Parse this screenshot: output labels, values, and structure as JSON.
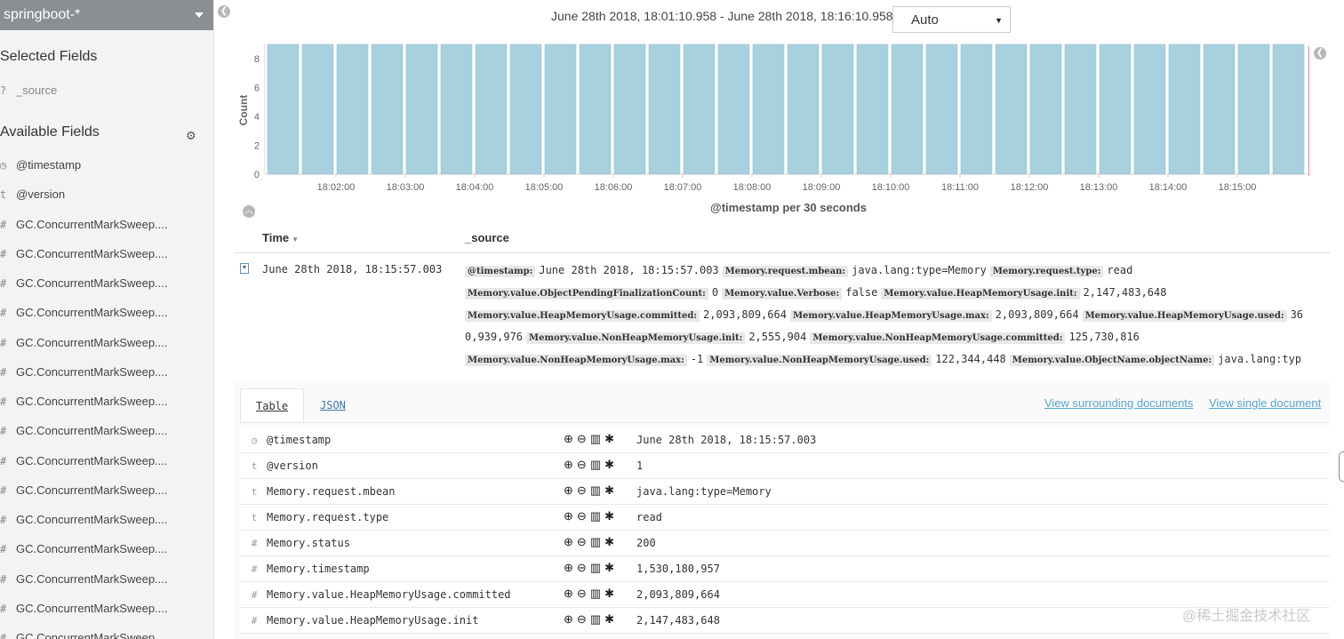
{
  "sidebar": {
    "index_pattern": "springboot-*",
    "selected_title": "Selected Fields",
    "selected_fields": [
      {
        "type": "?",
        "name": "_source"
      }
    ],
    "available_title": "Available Fields",
    "available_fields": [
      {
        "type": "clock",
        "name": "@timestamp"
      },
      {
        "type": "t",
        "name": "@version"
      },
      {
        "type": "#",
        "name": "GC.ConcurrentMarkSweep...."
      },
      {
        "type": "#",
        "name": "GC.ConcurrentMarkSweep...."
      },
      {
        "type": "#",
        "name": "GC.ConcurrentMarkSweep...."
      },
      {
        "type": "#",
        "name": "GC.ConcurrentMarkSweep...."
      },
      {
        "type": "#",
        "name": "GC.ConcurrentMarkSweep...."
      },
      {
        "type": "#",
        "name": "GC.ConcurrentMarkSweep...."
      },
      {
        "type": "#",
        "name": "GC.ConcurrentMarkSweep...."
      },
      {
        "type": "#",
        "name": "GC.ConcurrentMarkSweep...."
      },
      {
        "type": "#",
        "name": "GC.ConcurrentMarkSweep...."
      },
      {
        "type": "#",
        "name": "GC.ConcurrentMarkSweep...."
      },
      {
        "type": "#",
        "name": "GC.ConcurrentMarkSweep...."
      },
      {
        "type": "#",
        "name": "GC.ConcurrentMarkSweep...."
      },
      {
        "type": "#",
        "name": "GC.ConcurrentMarkSweep...."
      },
      {
        "type": "#",
        "name": "GC.ConcurrentMarkSweep...."
      },
      {
        "type": "#",
        "name": "GC.ConcurrentMarkSweep...."
      }
    ]
  },
  "header": {
    "time_range": "June 28th 2018, 18:01:10.958 - June 28th 2018, 18:16:10.958 —",
    "interval": "Auto"
  },
  "chart_data": {
    "type": "bar",
    "ylabel": "Count",
    "xlabel": "@timestamp per 30 seconds",
    "ylim": [
      0,
      9
    ],
    "yticks": [
      0,
      2,
      4,
      6,
      8
    ],
    "xticks": [
      "18:02:00",
      "18:03:00",
      "18:04:00",
      "18:05:00",
      "18:06:00",
      "18:07:00",
      "18:08:00",
      "18:09:00",
      "18:10:00",
      "18:11:00",
      "18:12:00",
      "18:13:00",
      "18:14:00",
      "18:15:00"
    ],
    "values": [
      9,
      9,
      9,
      9,
      9,
      9,
      9,
      9,
      9,
      9,
      9,
      9,
      9,
      9,
      9,
      9,
      9,
      9,
      9,
      9,
      9,
      9,
      9,
      9,
      9,
      9,
      9,
      9,
      9,
      9
    ],
    "bar_color": "#a8d0de"
  },
  "doc_table": {
    "col_time": "Time",
    "col_source": "_source",
    "row_time": "June 28th 2018, 18:15:57.003",
    "source_lines": [
      [
        [
          "@timestamp:",
          "June 28th 2018, 18:15:57.003"
        ],
        [
          "Memory.request.mbean:",
          "java.lang:type=Memory"
        ],
        [
          "Memory.request.type:",
          "read"
        ]
      ],
      [
        [
          "Memory.value.ObjectPendingFinalizationCount:",
          "0"
        ],
        [
          "Memory.value.Verbose:",
          "false"
        ],
        [
          "Memory.value.HeapMemoryUsage.init:",
          "2,147,483,648"
        ]
      ],
      [
        [
          "Memory.value.HeapMemoryUsage.committed:",
          "2,093,809,664"
        ],
        [
          "Memory.value.HeapMemoryUsage.max:",
          "2,093,809,664"
        ],
        [
          "Memory.value.HeapMemoryUsage.used:",
          "36"
        ]
      ],
      [
        [
          "",
          "0,939,976"
        ],
        [
          "Memory.value.NonHeapMemoryUsage.init:",
          "2,555,904"
        ],
        [
          "Memory.value.NonHeapMemoryUsage.committed:",
          "125,730,816"
        ]
      ],
      [
        [
          "Memory.value.NonHeapMemoryUsage.max:",
          "-1"
        ],
        [
          "Memory.value.NonHeapMemoryUsage.used:",
          "122,344,448"
        ],
        [
          "Memory.value.ObjectName.objectName:",
          "java.lang:typ"
        ]
      ]
    ]
  },
  "detail": {
    "tab_table": "Table",
    "tab_json": "JSON",
    "link_surrounding": "View surrounding documents",
    "link_single": "View single document",
    "rows": [
      {
        "type": "clock",
        "name": "@timestamp",
        "value": "June 28th 2018, 18:15:57.003"
      },
      {
        "type": "t",
        "name": "@version",
        "value": "1"
      },
      {
        "type": "t",
        "name": "Memory.request.mbean",
        "value": "java.lang:type=Memory"
      },
      {
        "type": "t",
        "name": "Memory.request.type",
        "value": "read"
      },
      {
        "type": "#",
        "name": "Memory.status",
        "value": "200"
      },
      {
        "type": "#",
        "name": "Memory.timestamp",
        "value": "1,530,180,957"
      },
      {
        "type": "#",
        "name": "Memory.value.HeapMemoryUsage.committed",
        "value": "2,093,809,664"
      },
      {
        "type": "#",
        "name": "Memory.value.HeapMemoryUsage.init",
        "value": "2,147,483,648"
      }
    ]
  },
  "watermark": "@稀土掘金技术社区"
}
